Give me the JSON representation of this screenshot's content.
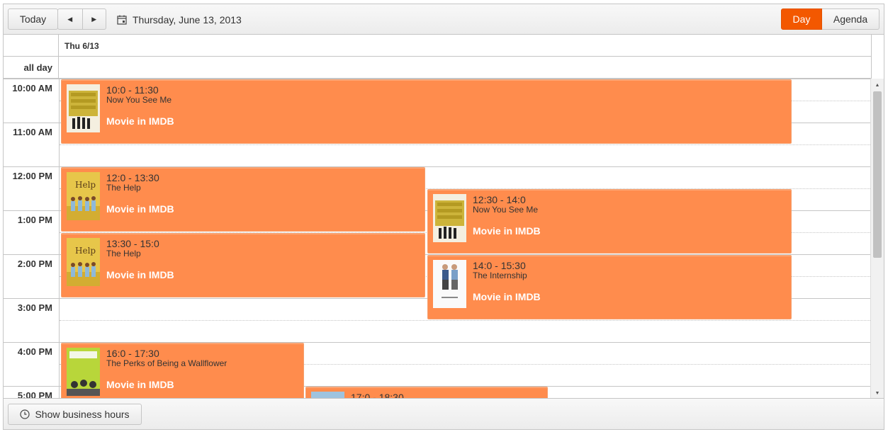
{
  "toolbar": {
    "today_label": "Today",
    "prev_icon": "◀",
    "next_icon": "▶",
    "date_label": "Thursday, June 13, 2013",
    "views": [
      {
        "label": "Day",
        "selected": true
      },
      {
        "label": "Agenda",
        "selected": false
      }
    ]
  },
  "header": {
    "day_label": "Thu 6/13"
  },
  "allday_label": "all day",
  "time_slots": [
    "10:00 AM",
    "11:00 AM",
    "12:00 PM",
    "1:00 PM",
    "2:00 PM",
    "3:00 PM",
    "4:00 PM",
    "5:00 PM"
  ],
  "events": [
    {
      "time": "10:0 - 11:30",
      "title": "Now You See Me",
      "link": "Movie in IMDB",
      "poster": "now-you-see-me"
    },
    {
      "time": "12:0 - 13:30",
      "title": "The Help",
      "link": "Movie in IMDB",
      "poster": "the-help"
    },
    {
      "time": "12:30 - 14:0",
      "title": "Now You See Me",
      "link": "Movie in IMDB",
      "poster": "now-you-see-me"
    },
    {
      "time": "13:30 - 15:0",
      "title": "The Help",
      "link": "Movie in IMDB",
      "poster": "the-help"
    },
    {
      "time": "14:0 - 15:30",
      "title": "The Internship",
      "link": "Movie in IMDB",
      "poster": "the-internship"
    },
    {
      "time": "16:0 - 17:30",
      "title": "The Perks of Being a Wallflower",
      "link": "Movie in IMDB",
      "poster": "perks-wallflower"
    },
    {
      "time": "17:0 - 18:30",
      "title": "",
      "link": "",
      "poster": "generic"
    }
  ],
  "footer": {
    "business_hours_label": "Show business hours"
  },
  "colors": {
    "accent": "#f35800",
    "event": "#ff8c4d"
  }
}
